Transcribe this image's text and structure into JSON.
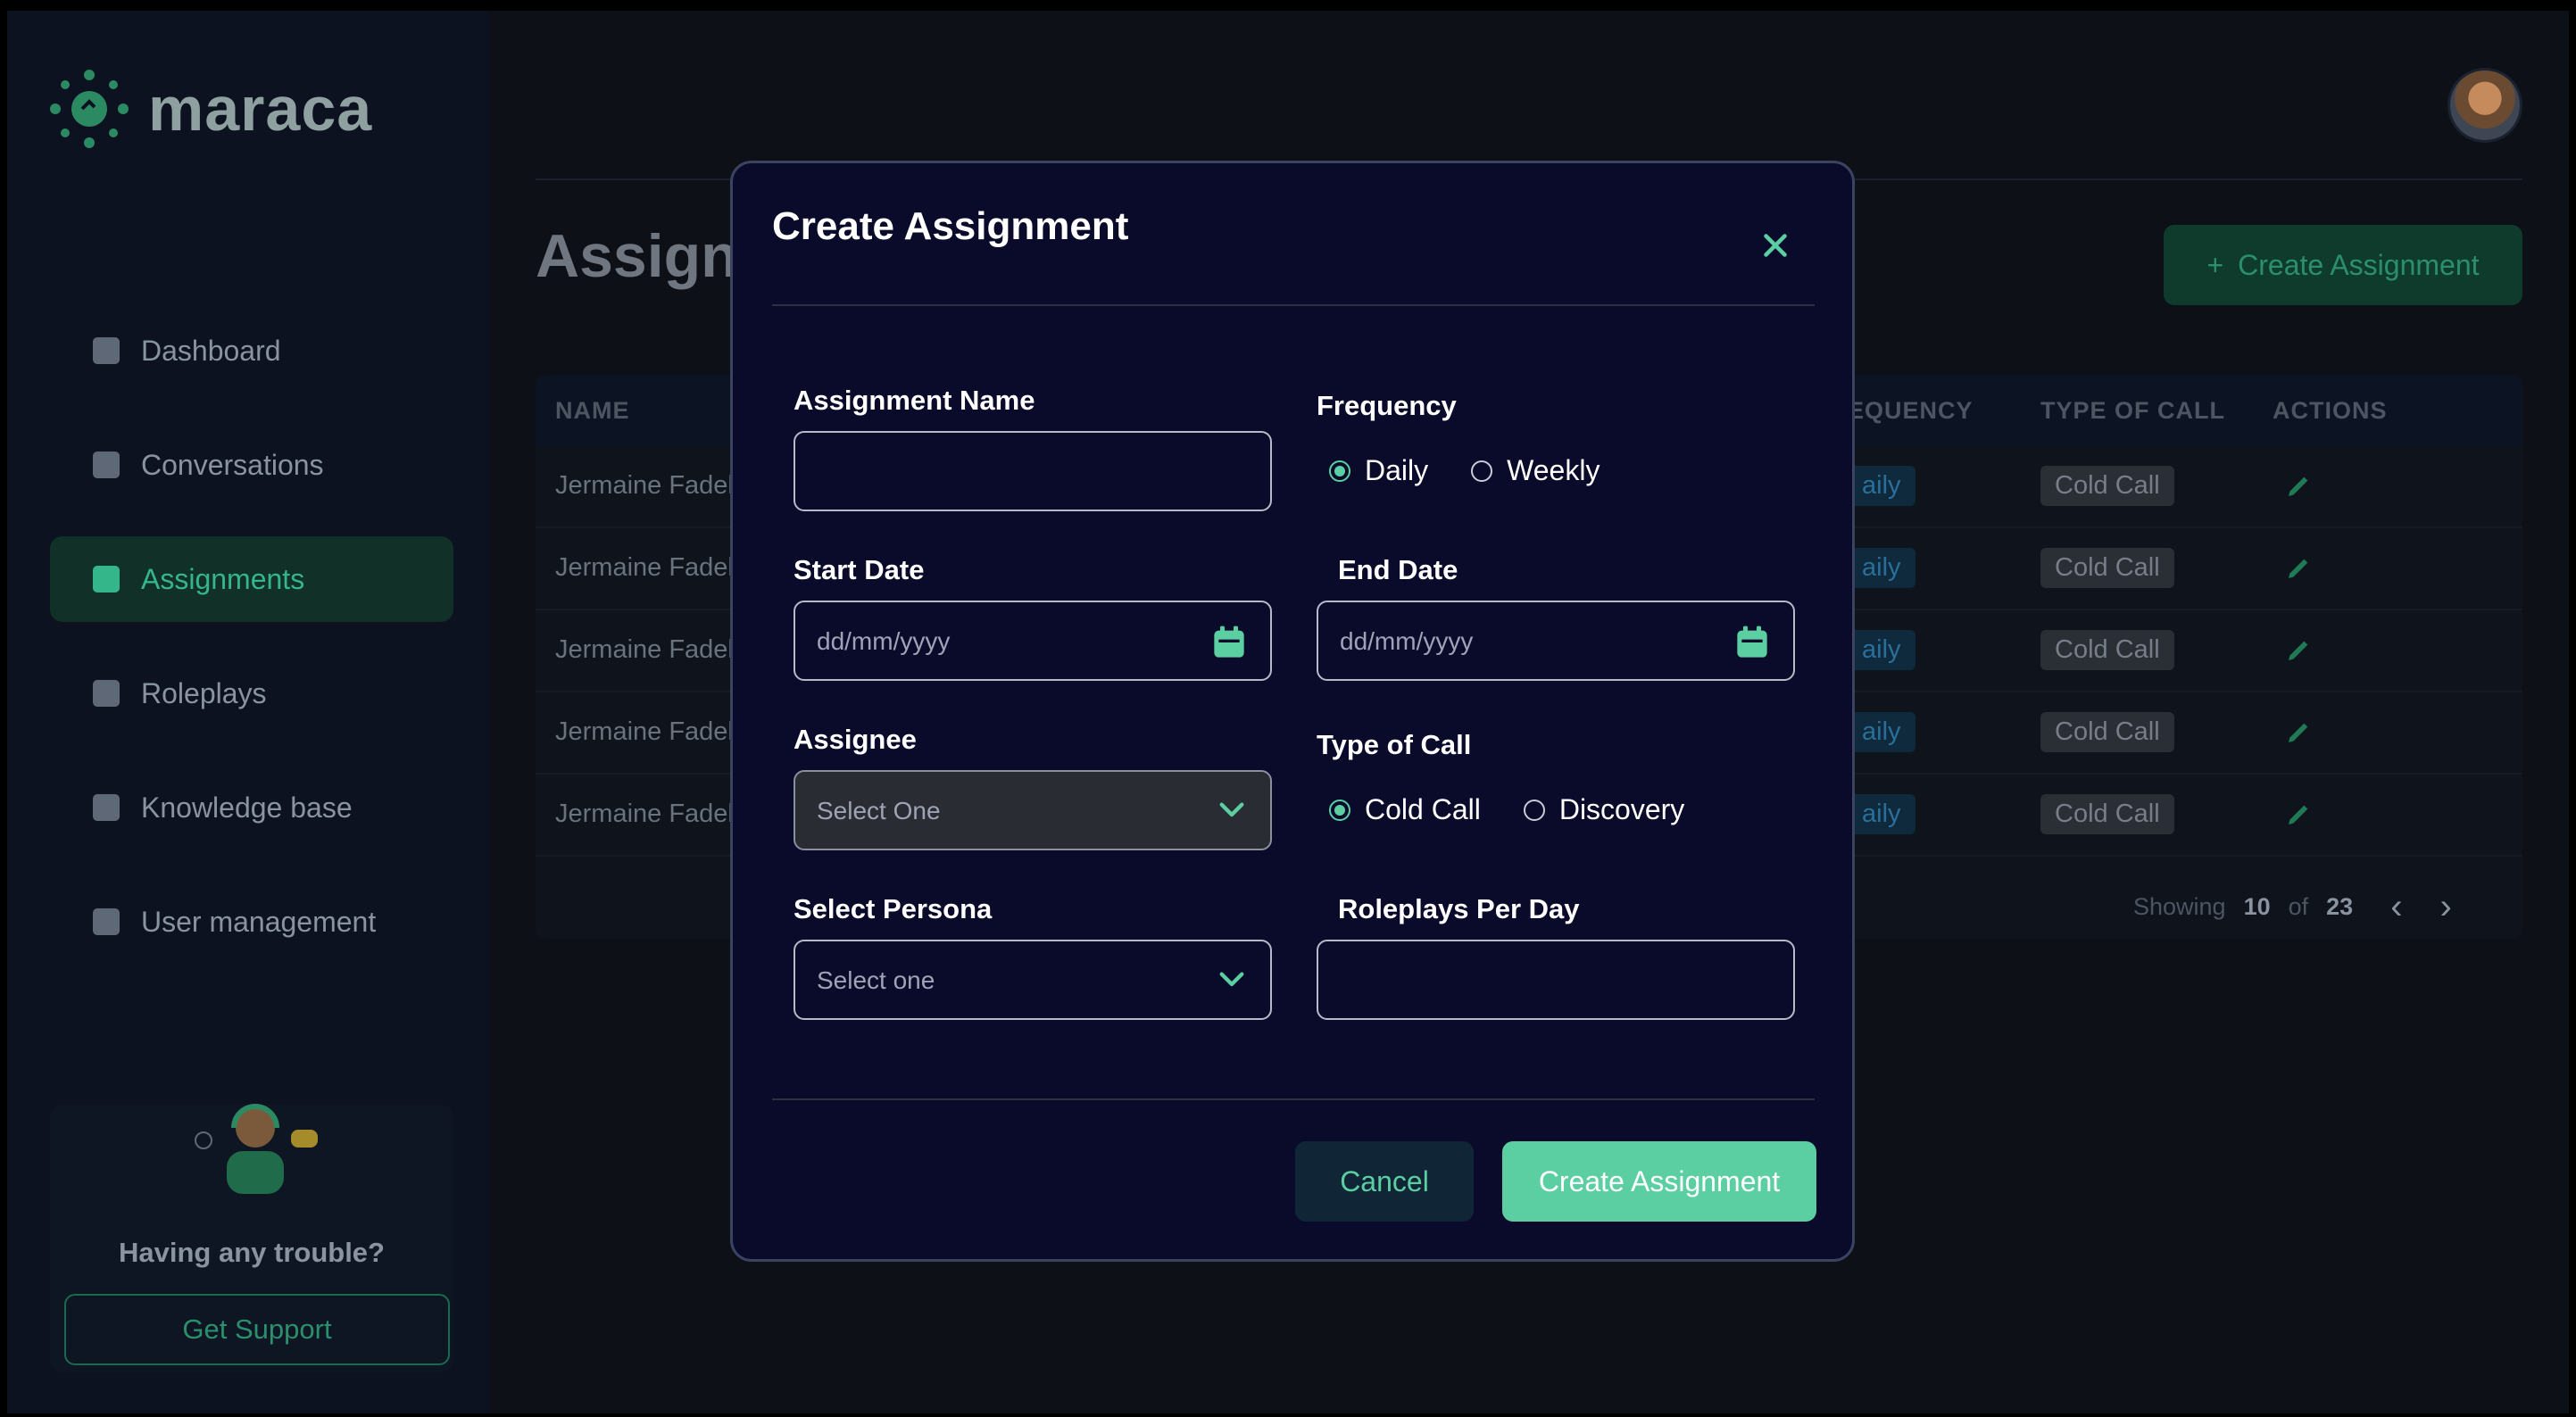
{
  "app": {
    "brand": "maraca"
  },
  "sidebar": {
    "items": [
      {
        "label": "Dashboard",
        "icon": "dashboard-icon"
      },
      {
        "label": "Conversations",
        "icon": "chat-icon"
      },
      {
        "label": "Assignments",
        "icon": "assignment-icon",
        "active": true
      },
      {
        "label": "Roleplays",
        "icon": "roleplay-icon"
      },
      {
        "label": "Knowledge base",
        "icon": "book-icon"
      },
      {
        "label": "User management",
        "icon": "user-settings-icon"
      }
    ],
    "support": {
      "text": "Having any trouble?",
      "button": "Get Support"
    }
  },
  "page": {
    "title": "Assignm",
    "create_button": "Create Assignment",
    "table": {
      "headers": {
        "name": "NAME",
        "frequency": "EQUENCY",
        "type": "TYPE OF CALL",
        "actions": "ACTIONS"
      },
      "rows": [
        {
          "name": "Jermaine Fadel",
          "frequency": "aily",
          "type": "Cold Call"
        },
        {
          "name": "Jermaine Fadel",
          "frequency": "aily",
          "type": "Cold Call"
        },
        {
          "name": "Jermaine Fadel",
          "frequency": "aily",
          "type": "Cold Call"
        },
        {
          "name": "Jermaine Fadel",
          "frequency": "aily",
          "type": "Cold Call"
        },
        {
          "name": "Jermaine Fadel",
          "frequency": "aily",
          "type": "Cold Call"
        }
      ],
      "footer": {
        "showing": "Showing",
        "count": "10",
        "of": "of",
        "total": "23"
      }
    }
  },
  "modal": {
    "title": "Create Assignment",
    "assignment_name": {
      "label": "Assignment Name",
      "value": ""
    },
    "frequency": {
      "label": "Frequency",
      "options": [
        "Daily",
        "Weekly"
      ],
      "selected": "Daily"
    },
    "start_date": {
      "label": "Start Date",
      "placeholder": "dd/mm/yyyy"
    },
    "end_date": {
      "label": "End Date",
      "placeholder": "dd/mm/yyyy"
    },
    "assignee": {
      "label": "Assignee",
      "placeholder": "Select One"
    },
    "type_of_call": {
      "label": "Type of Call",
      "options": [
        "Cold Call",
        "Discovery"
      ],
      "selected": "Cold Call"
    },
    "persona": {
      "label": "Select Persona",
      "placeholder": "Select one"
    },
    "roleplays_per_day": {
      "label": "Roleplays Per Day",
      "value": ""
    },
    "cancel_label": "Cancel",
    "submit_label": "Create Assignment"
  },
  "colors": {
    "accent": "#5ccfa2",
    "modal_bg": "#0a0b2b",
    "backdrop": "#0d1017"
  }
}
